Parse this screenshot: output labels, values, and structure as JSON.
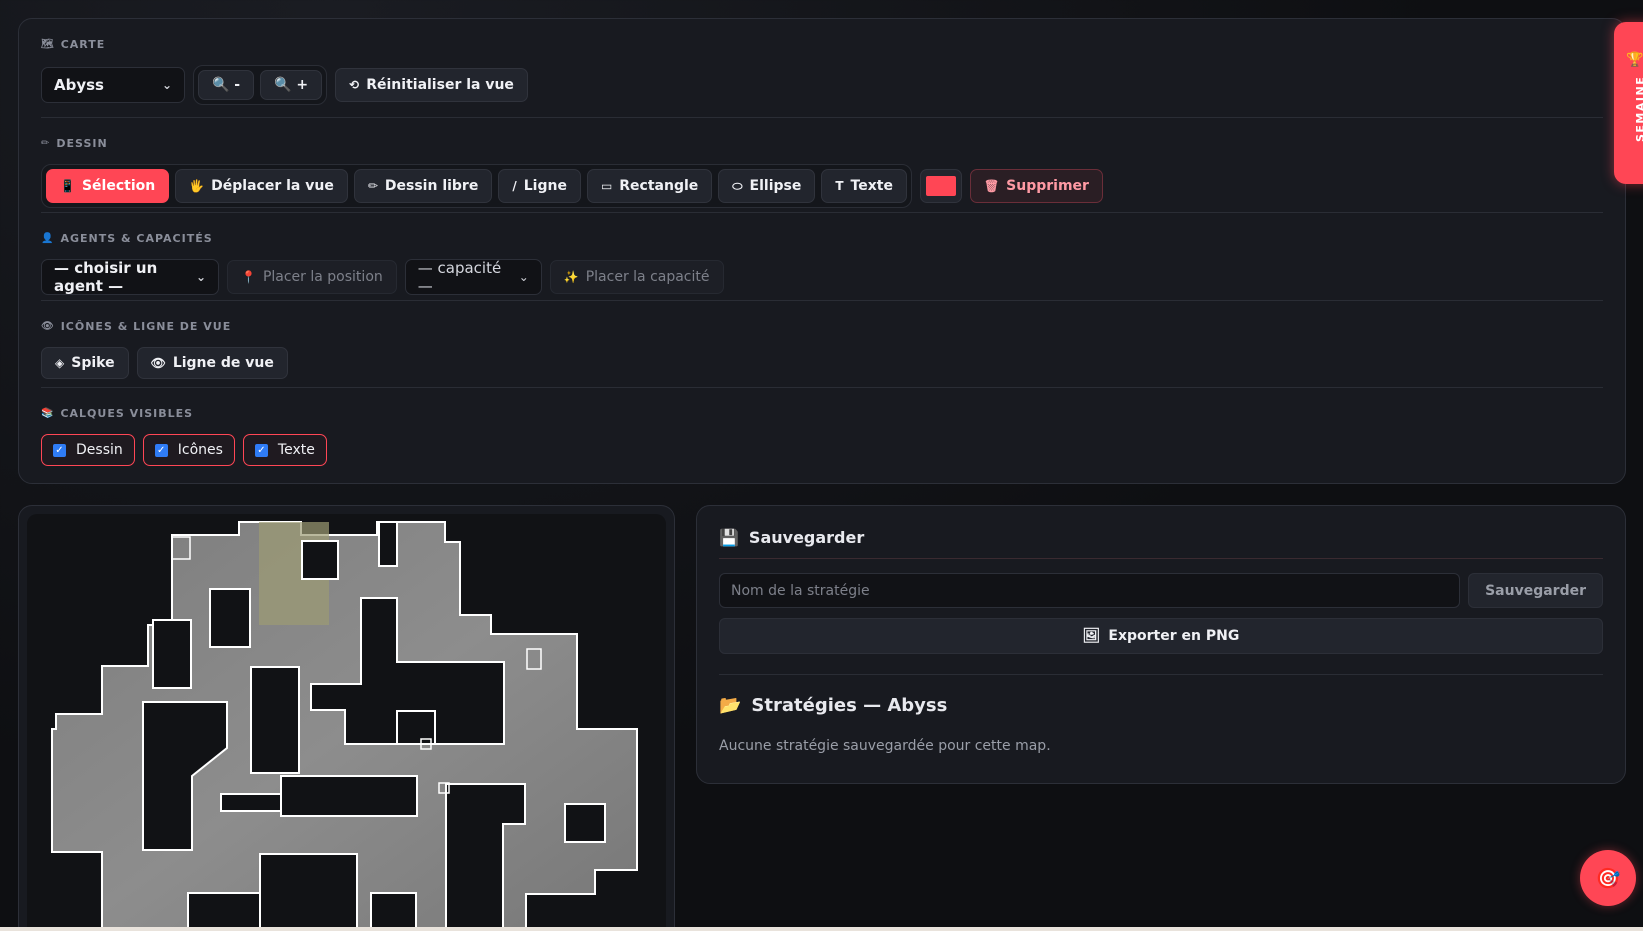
{
  "toolbar": {
    "carte": {
      "title": "CARTE",
      "map_select": "Abyss",
      "zoom_out": "🔍 -",
      "zoom_in": "🔍 +",
      "reset": "Réinitialiser la vue"
    },
    "dessin": {
      "title": "DESSIN",
      "tools": [
        {
          "label": "Sélection",
          "icon": "📱",
          "active": true
        },
        {
          "label": "Déplacer la vue",
          "icon": "🖐"
        },
        {
          "label": "Dessin libre",
          "icon": "✏"
        },
        {
          "label": "Ligne",
          "icon": "/"
        },
        {
          "label": "Rectangle",
          "icon": "▭"
        },
        {
          "label": "Ellipse",
          "icon": "⬭"
        },
        {
          "label": "Texte",
          "icon": "T"
        }
      ],
      "color": "#ff4655",
      "delete": "Supprimer"
    },
    "agents": {
      "title": "AGENTS & CAPACITÉS",
      "agent_select": "— choisir un agent —",
      "place_position": "Placer la position",
      "ability_select": "— capacité —",
      "place_ability": "Placer la capacité"
    },
    "icones": {
      "title": "ICÔNES & LIGNE DE VUE",
      "spike": "Spike",
      "line_of_sight": "Ligne de vue"
    },
    "calques": {
      "title": "CALQUES VISIBLES",
      "layers": [
        "Dessin",
        "Icônes",
        "Texte"
      ]
    }
  },
  "save": {
    "title": "Sauvegarder",
    "name_placeholder": "Nom de la stratégie",
    "save_button": "Sauvegarder",
    "export_button": "Exporter en PNG",
    "strategies_title": "Stratégies — Abyss",
    "empty_text": "Aucune stratégie sauvegardée pour cette map."
  },
  "weekly_tab": "SEMAINE",
  "colors": {
    "accent": "#ff4655",
    "bg": "#0f1013",
    "panel": "#181a20"
  }
}
